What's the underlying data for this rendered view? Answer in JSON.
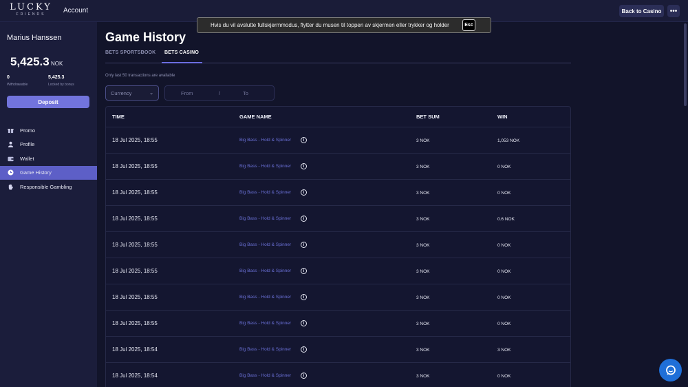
{
  "header": {
    "logo_main": "LUCKY",
    "logo_sub": "FRIENDS",
    "account_label": "Account",
    "back_button": "Back to Casino",
    "more_button": "•••"
  },
  "toast": {
    "message": "Hvis du vil avslutte fullskjermmodus, flytter du musen til toppen av skjermen eller trykker og holder",
    "key": "Esc"
  },
  "sidebar": {
    "user_name": "Marius Hanssen",
    "balance": "5,425.3",
    "currency": "NOK",
    "withdrawable_value": "0",
    "withdrawable_label": "Withdrawable",
    "locked_value": "5,425.3",
    "locked_label": "Locked by bonus",
    "deposit_button": "Deposit",
    "nav_items": [
      {
        "label": "Promo",
        "icon": "gift-icon",
        "active": false
      },
      {
        "label": "Profile",
        "icon": "user-icon",
        "active": false
      },
      {
        "label": "Wallet",
        "icon": "wallet-icon",
        "active": false
      },
      {
        "label": "Game History",
        "icon": "clock-icon",
        "active": true
      },
      {
        "label": "Responsible Gambling",
        "icon": "hand-icon",
        "active": false
      }
    ]
  },
  "main": {
    "title": "Game History",
    "tabs": [
      {
        "label": "BETS SPORTSBOOK",
        "active": false
      },
      {
        "label": "BETS CASINO",
        "active": true
      }
    ],
    "note": "Only last 50 transactions are available",
    "currency_placeholder": "Currency",
    "date_from": "From",
    "date_sep": "/",
    "date_to": "To",
    "table": {
      "headers": [
        "TIME",
        "GAME NAME",
        "BET SUM",
        "WIN"
      ],
      "rows": [
        {
          "time": "18 Jul 2025, 18:55",
          "game": "Big Bass - Hold & Spinner",
          "bet": "3 NOK",
          "win": "1,053 NOK"
        },
        {
          "time": "18 Jul 2025, 18:55",
          "game": "Big Bass - Hold & Spinner",
          "bet": "3 NOK",
          "win": "0 NOK"
        },
        {
          "time": "18 Jul 2025, 18:55",
          "game": "Big Bass - Hold & Spinner",
          "bet": "3 NOK",
          "win": "0 NOK"
        },
        {
          "time": "18 Jul 2025, 18:55",
          "game": "Big Bass - Hold & Spinner",
          "bet": "3 NOK",
          "win": "0.6 NOK"
        },
        {
          "time": "18 Jul 2025, 18:55",
          "game": "Big Bass - Hold & Spinner",
          "bet": "3 NOK",
          "win": "0 NOK"
        },
        {
          "time": "18 Jul 2025, 18:55",
          "game": "Big Bass - Hold & Spinner",
          "bet": "3 NOK",
          "win": "0 NOK"
        },
        {
          "time": "18 Jul 2025, 18:55",
          "game": "Big Bass - Hold & Spinner",
          "bet": "3 NOK",
          "win": "0 NOK"
        },
        {
          "time": "18 Jul 2025, 18:55",
          "game": "Big Bass - Hold & Spinner",
          "bet": "3 NOK",
          "win": "0 NOK"
        },
        {
          "time": "18 Jul 2025, 18:54",
          "game": "Big Bass - Hold & Spinner",
          "bet": "3 NOK",
          "win": "3 NOK"
        },
        {
          "time": "18 Jul 2025, 18:54",
          "game": "Big Bass - Hold & Spinner",
          "bet": "3 NOK",
          "win": "0 NOK"
        }
      ]
    }
  },
  "colors": {
    "background": "#12142a",
    "sidebar": "#1b1d3b",
    "accent": "#7274dc",
    "active_nav": "#5d5fc7",
    "link": "#6a70d6",
    "chat": "#1f6fd8"
  }
}
